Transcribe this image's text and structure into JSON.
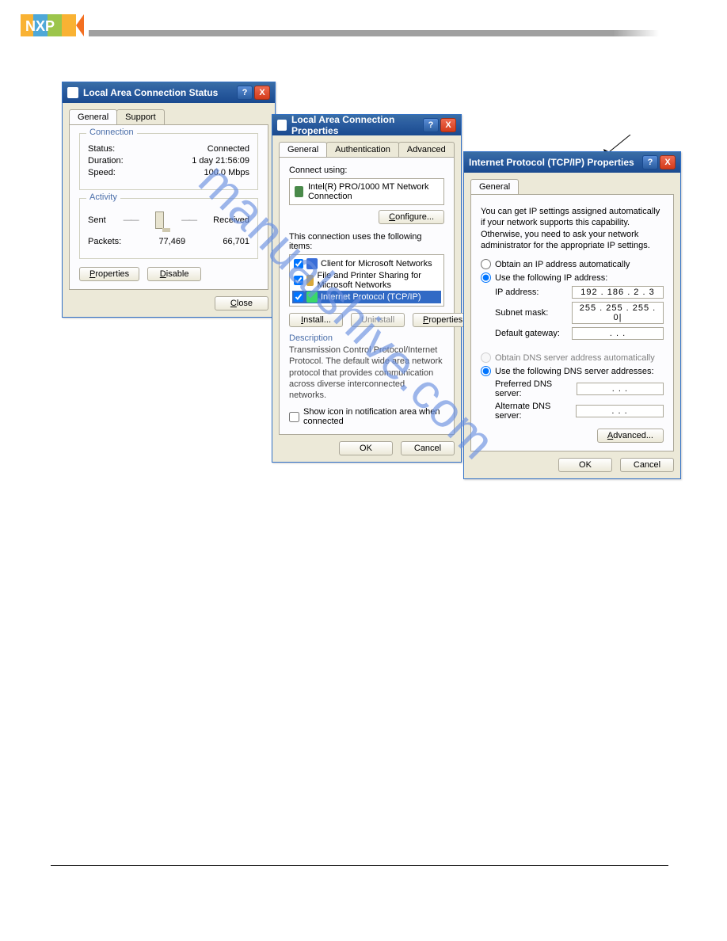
{
  "logo": {
    "brand": "NXP"
  },
  "arrow_indicator": "arrow",
  "watermark": "manualshive.com",
  "status_window": {
    "title": "Local Area Connection Status",
    "tabs": {
      "general": "General",
      "support": "Support"
    },
    "connection_group": {
      "legend": "Connection",
      "status_label": "Status:",
      "status_value": "Connected",
      "duration_label": "Duration:",
      "duration_value": "1 day 21:56:09",
      "speed_label": "Speed:",
      "speed_value": "100.0 Mbps"
    },
    "activity_group": {
      "legend": "Activity",
      "sent_label": "Sent",
      "received_label": "Received",
      "packets_label": "Packets:",
      "packets_sent": "77,469",
      "packets_received": "66,701"
    },
    "buttons": {
      "properties": "Properties",
      "disable": "Disable",
      "close": "Close"
    }
  },
  "props_window": {
    "title": "Local Area Connection Properties",
    "tabs": {
      "general": "General",
      "authentication": "Authentication",
      "advanced": "Advanced"
    },
    "connect_using_label": "Connect using:",
    "adapter": "Intel(R) PRO/1000 MT Network Connection",
    "configure_btn": "Configure...",
    "items_label": "This connection uses the following items:",
    "items": [
      {
        "label": "Client for Microsoft Networks",
        "selected": false
      },
      {
        "label": "File and Printer Sharing for Microsoft Networks",
        "selected": false
      },
      {
        "label": "Internet Protocol (TCP/IP)",
        "selected": true
      }
    ],
    "buttons": {
      "install": "Install...",
      "uninstall": "Uninstall",
      "properties": "Properties"
    },
    "description": {
      "title": "Description",
      "text": "Transmission Control Protocol/Internet Protocol. The default wide area network protocol that provides communication across diverse interconnected networks."
    },
    "show_icon_checkbox": "Show icon in notification area when connected",
    "footer": {
      "ok": "OK",
      "cancel": "Cancel"
    }
  },
  "tcpip_window": {
    "title": "Internet Protocol (TCP/IP) Properties",
    "tabs": {
      "general": "General"
    },
    "note": "You can get IP settings assigned automatically if your network supports this capability. Otherwise, you need to ask your network administrator for the appropriate IP settings.",
    "radio_auto_ip": "Obtain an IP address automatically",
    "radio_use_ip": "Use the following IP address:",
    "ip_label": "IP address:",
    "ip_value": "192 . 186 .  2  .  3",
    "subnet_label": "Subnet mask:",
    "subnet_value": "255 . 255 . 255 .  0|",
    "gateway_label": "Default gateway:",
    "gateway_value": ".     .     .",
    "radio_auto_dns": "Obtain DNS server address automatically",
    "radio_use_dns": "Use the following DNS server addresses:",
    "pref_dns_label": "Preferred DNS server:",
    "pref_dns_value": ".     .     .",
    "alt_dns_label": "Alternate DNS server:",
    "alt_dns_value": ".     .     .",
    "advanced_btn": "Advanced...",
    "footer": {
      "ok": "OK",
      "cancel": "Cancel"
    }
  }
}
